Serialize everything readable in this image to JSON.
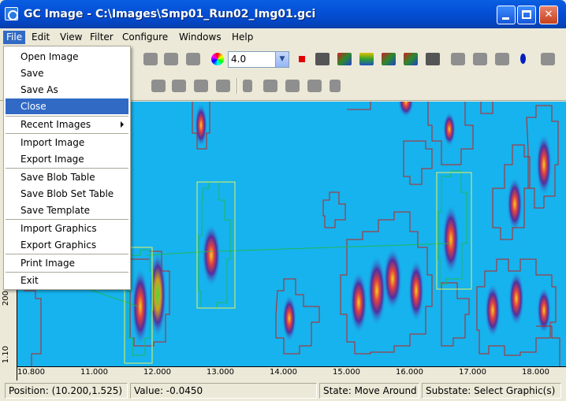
{
  "window": {
    "title": "GC Image - C:\\Images\\Smp01_Run02_Img01.gci",
    "minimize_label": "",
    "maximize_label": "",
    "close_label": "✕"
  },
  "menubar": {
    "items": [
      "File",
      "Edit",
      "View",
      "Filter",
      "Configure",
      "Windows",
      "Help"
    ]
  },
  "file_menu": {
    "items": [
      {
        "label": "Open Image"
      },
      {
        "label": "Save"
      },
      {
        "label": "Save As"
      },
      {
        "label": "Close"
      },
      {
        "label": "Recent Images"
      },
      {
        "label": "Import Image"
      },
      {
        "label": "Export Image"
      },
      {
        "label": "Save Blob Table"
      },
      {
        "label": "Save Blob Set Table"
      },
      {
        "label": "Save Template"
      },
      {
        "label": "Import Graphics"
      },
      {
        "label": "Export Graphics"
      },
      {
        "label": "Print Image"
      },
      {
        "label": "Exit"
      }
    ],
    "highlighted": "Close"
  },
  "toolbar": {
    "zoom_value": "4.0",
    "zoom_arrow": "▼"
  },
  "axis": {
    "x_ticks": [
      "10.800",
      "11.000",
      "12.000",
      "13.000",
      "14.000",
      "15.000",
      "16.000",
      "17.000",
      "18.000"
    ],
    "y_ticks": [
      "1.10",
      "200"
    ]
  },
  "status": {
    "position": "Position: (10.200,1.525)",
    "value": "Value: -0.0450",
    "state": "State: Move Around",
    "substate": "Substate: Select Graphic(s)"
  },
  "colors": {
    "background": "#16b3ee",
    "blob_outline": "#c0201c",
    "selection_box": "#e8f060",
    "highlight": "#316ac5"
  }
}
